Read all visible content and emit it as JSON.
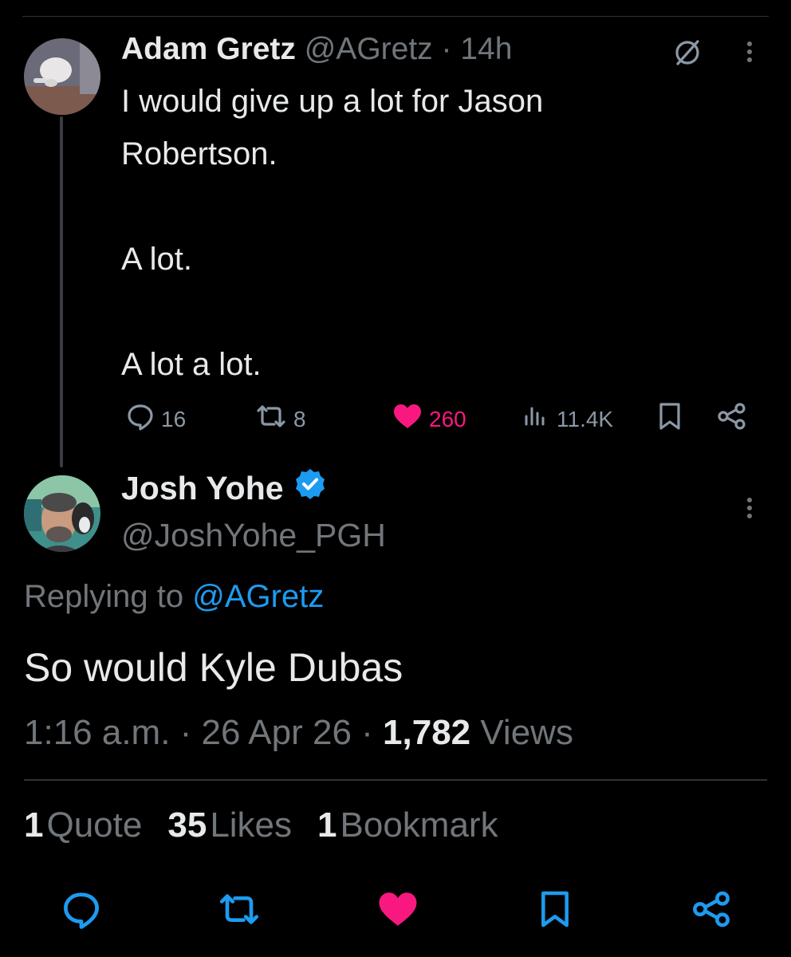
{
  "tweet1": {
    "author_name": "Adam Gretz",
    "author_handle": "@AGretz",
    "time": "14h",
    "body_lines": [
      "I would give up a lot for Jason Robertson.",
      "A lot.",
      "A lot a lot."
    ],
    "stats": {
      "replies": "16",
      "retweets": "8",
      "likes": "260",
      "views": "11.4K"
    }
  },
  "tweet2": {
    "author_name": "Josh Yohe",
    "author_handle": "@JoshYohe_PGH",
    "replying_prefix": "Replying to",
    "replying_to": "@AGretz",
    "body": "So would Kyle Dubas",
    "time": "1:16 a.m.",
    "date": "26 Apr 26",
    "views_count": "1,782",
    "views_label": "Views",
    "quotes_count": "1",
    "quotes_label": "Quote",
    "likes_count": "35",
    "likes_label": "Likes",
    "bookmarks_count": "1",
    "bookmarks_label": "Bookmark"
  },
  "colors": {
    "accent": "#1d9bf0",
    "like": "#f91880",
    "muted": "#71767b",
    "text": "#e7e9ea",
    "background": "#000000"
  },
  "icons": [
    "grok-icon",
    "more-icon",
    "reply-icon",
    "retweet-icon",
    "heart-icon",
    "views-icon",
    "bookmark-icon",
    "share-icon",
    "verified-badge-icon"
  ]
}
